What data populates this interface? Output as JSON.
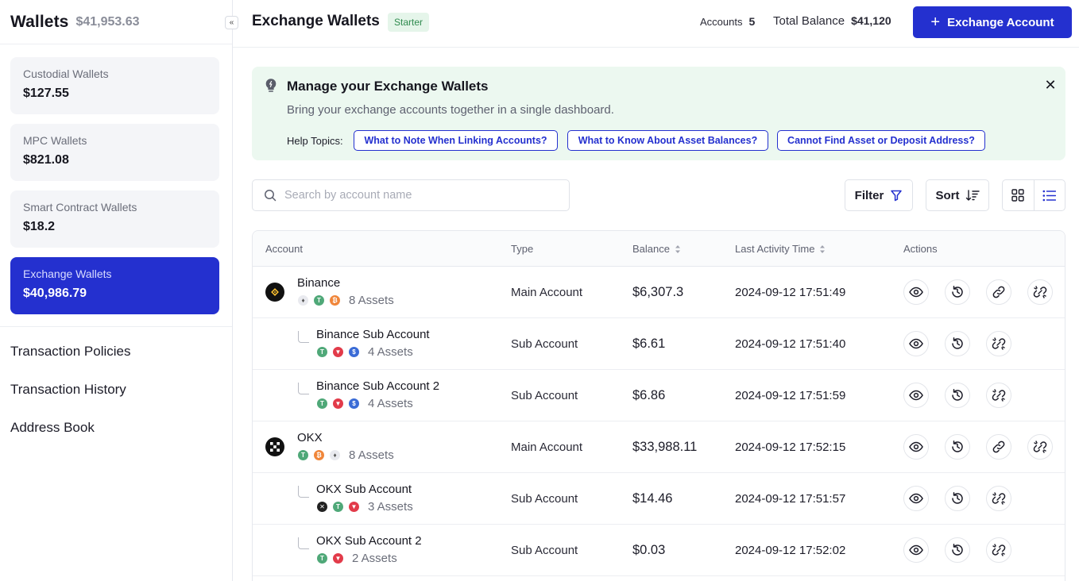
{
  "sidebar": {
    "title": "Wallets",
    "total": "$41,953.63",
    "collapse_glyph": "«",
    "wallets": [
      {
        "label": "Custodial Wallets",
        "amount": "$127.55"
      },
      {
        "label": "MPC Wallets",
        "amount": "$821.08"
      },
      {
        "label": "Smart Contract Wallets",
        "amount": "$18.2"
      },
      {
        "label": "Exchange Wallets",
        "amount": "$40,986.79"
      }
    ],
    "links": [
      "Transaction Policies",
      "Transaction History",
      "Address Book"
    ]
  },
  "header": {
    "title": "Exchange Wallets",
    "badge": "Starter",
    "accounts_label": "Accounts",
    "accounts_value": "5",
    "balance_label": "Total Balance",
    "balance_value": "$41,120",
    "add_button": "Exchange Account"
  },
  "banner": {
    "title": "Manage your Exchange Wallets",
    "subtitle": "Bring your exchange accounts together in a single dashboard.",
    "help_label": "Help Topics:",
    "topics": [
      "What to Note When Linking Accounts?",
      "What to Know About Asset Balances?",
      "Cannot Find Asset or Deposit Address?"
    ],
    "close_glyph": "✕"
  },
  "toolbar": {
    "search_placeholder": "Search by account name",
    "filter_label": "Filter",
    "sort_label": "Sort"
  },
  "table": {
    "columns": [
      "Account",
      "Type",
      "Balance",
      "Last Activity Time",
      "Actions"
    ],
    "rows": [
      {
        "name": "Binance",
        "assets": "8 Assets",
        "type": "Main Account",
        "balance": "$6,307.3",
        "time": "2024-09-12 17:51:49"
      },
      {
        "name": "Binance Sub Account",
        "assets": "4 Assets",
        "type": "Sub Account",
        "balance": "$6.61",
        "time": "2024-09-12 17:51:40"
      },
      {
        "name": "Binance Sub Account 2",
        "assets": "4 Assets",
        "type": "Sub Account",
        "balance": "$6.86",
        "time": "2024-09-12 17:51:59"
      },
      {
        "name": "OKX",
        "assets": "8 Assets",
        "type": "Main Account",
        "balance": "$33,988.11",
        "time": "2024-09-12 17:52:15"
      },
      {
        "name": "OKX Sub Account",
        "assets": "3 Assets",
        "type": "Sub Account",
        "balance": "$14.46",
        "time": "2024-09-12 17:51:57"
      },
      {
        "name": "OKX Sub Account 2",
        "assets": "2 Assets",
        "type": "Sub Account",
        "balance": "$0.03",
        "time": "2024-09-12 17:52:02"
      }
    ]
  },
  "colors": {
    "accent": "#2430cf",
    "banner_bg": "#ecf8f0",
    "badge_bg": "#e5f5ea",
    "badge_text": "#2e8a4e",
    "coin_tether": "#4fa878",
    "coin_bitcoin": "#f0863a",
    "coin_tron": "#e23b4a",
    "coin_usdc": "#3a6bd6",
    "coin_eth": "#e9eaef"
  },
  "icons": [
    "bulb-icon",
    "close-icon",
    "search-icon",
    "filter-icon",
    "sort-icon",
    "grid-view-icon",
    "list-view-icon",
    "eye-icon",
    "history-icon",
    "link-icon",
    "unlink-icon",
    "binance-logo",
    "okx-logo"
  ]
}
